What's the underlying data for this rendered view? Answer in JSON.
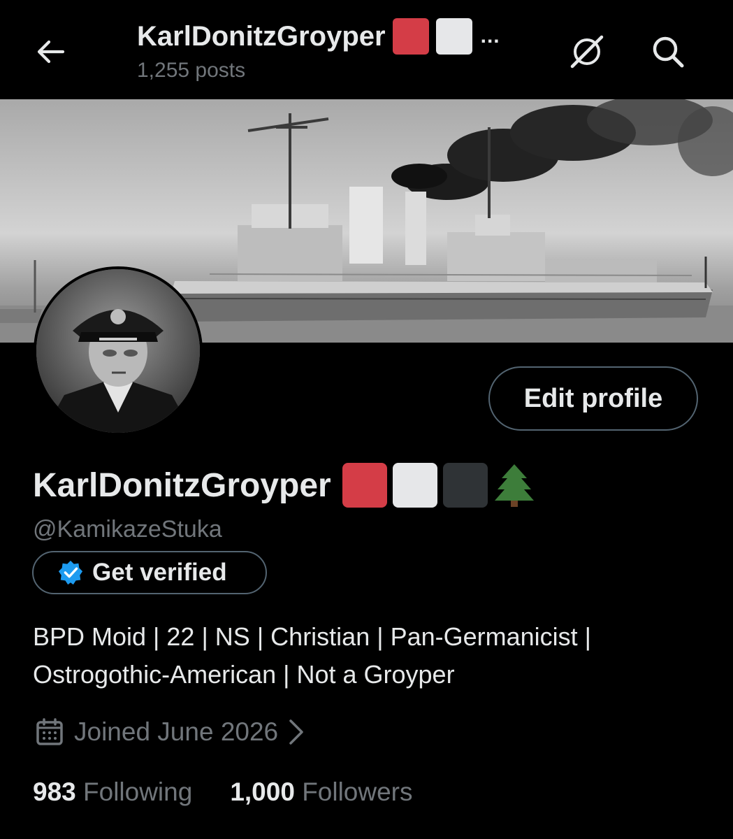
{
  "header": {
    "title": "KarlDonitzGroyper",
    "posts_count": "1,255 posts",
    "ellipsis": "..."
  },
  "profile": {
    "display_name": "KarlDonitzGroyper",
    "handle": "@KamikazeStuka",
    "verify_label": "Get verified",
    "edit_label": "Edit profile",
    "bio_line1": "BPD Moid | 22 | NS | Christian | Pan-Germanicist |",
    "bio_line2": "Ostrogothic-American | Not a Groyper",
    "joined": "Joined June 2026",
    "following_count": "983",
    "following_label": "Following",
    "followers_count": "1,000",
    "followers_label": "Followers",
    "name_emojis": [
      "red-square",
      "white-square",
      "black-square",
      "evergreen-tree"
    ]
  },
  "colors": {
    "background": "#000000",
    "text": "#e7e9ea",
    "muted": "#71767b",
    "border": "#536471",
    "verified_blue": "#1d9bf0",
    "emoji_red": "#d43d47",
    "emoji_white": "#e6e7e9",
    "emoji_black": "#2f3336"
  },
  "icons": [
    "back-arrow-icon",
    "grok-icon",
    "search-icon",
    "verified-badge-icon",
    "calendar-icon",
    "chevron-right-icon"
  ]
}
